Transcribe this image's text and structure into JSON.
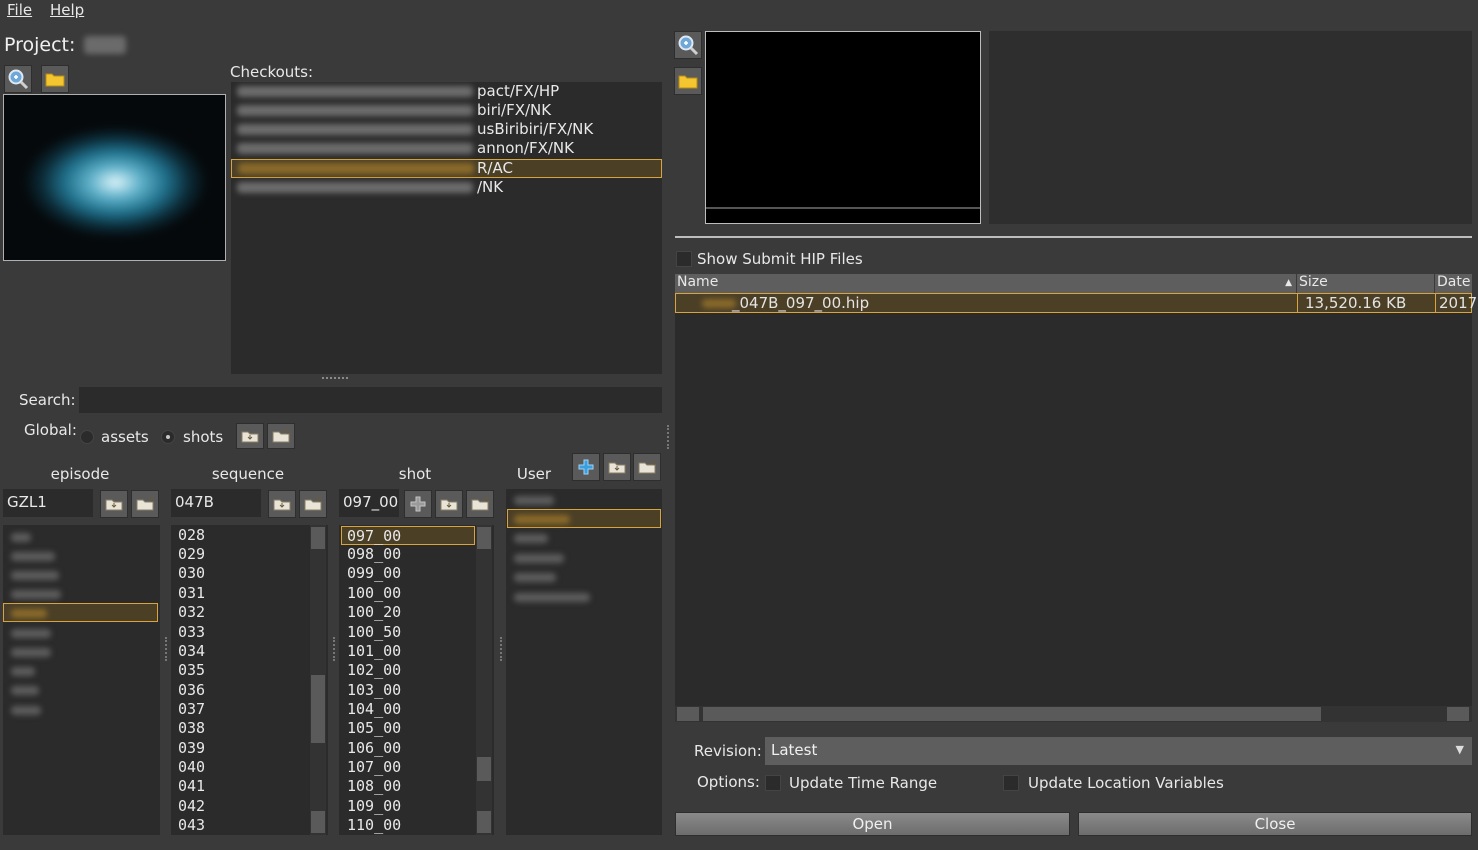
{
  "menu": {
    "file": "File",
    "help": "Help"
  },
  "project": {
    "label": "Project:"
  },
  "checkouts": {
    "label": "Checkouts:",
    "rows": [
      "pact/FX/HP",
      "biri/FX/NK",
      "usBiribiri/FX/NK",
      "annon/FX/NK",
      "R/AC",
      "/NK"
    ],
    "selected_index": 4
  },
  "search": {
    "label": "Search:",
    "value": ""
  },
  "global": {
    "label": "Global:",
    "assets": "assets",
    "shots": "shots",
    "selected": "shots"
  },
  "columns": {
    "episode": "episode",
    "sequence": "sequence",
    "shot": "shot",
    "user": "User"
  },
  "episode": {
    "value": "GZL1"
  },
  "sequence": {
    "value": "047B",
    "items": [
      "028",
      "029",
      "030",
      "031",
      "032",
      "033",
      "034",
      "035",
      "036",
      "037",
      "038",
      "039",
      "040",
      "041",
      "042",
      "043"
    ]
  },
  "shot": {
    "value": "097_00",
    "items": [
      "097_00",
      "098_00",
      "099_00",
      "100_00",
      "100_20",
      "100_50",
      "101_00",
      "102_00",
      "103_00",
      "104_00",
      "105_00",
      "106_00",
      "107_00",
      "108_00",
      "109_00",
      "110_00"
    ],
    "selected_index": 0
  },
  "files": {
    "show_submit_label": "Show Submit HIP Files",
    "headers": {
      "name": "Name",
      "size": "Size",
      "date": "Date"
    },
    "rows": [
      {
        "name": "_047B_097_00.hip",
        "size": "13,520.16 KB",
        "date": "2017"
      }
    ]
  },
  "revision": {
    "label": "Revision:",
    "value": "Latest"
  },
  "options": {
    "label": "Options:",
    "update_time_range": "Update Time Range",
    "update_location_variables": "Update Location Variables"
  },
  "buttons": {
    "open": "Open",
    "close": "Close"
  },
  "colors": {
    "background": "#3a3a3a",
    "panel": "#2b2b2b",
    "selection_border": "#d8a440",
    "selection_fill": "#4b3f26"
  }
}
